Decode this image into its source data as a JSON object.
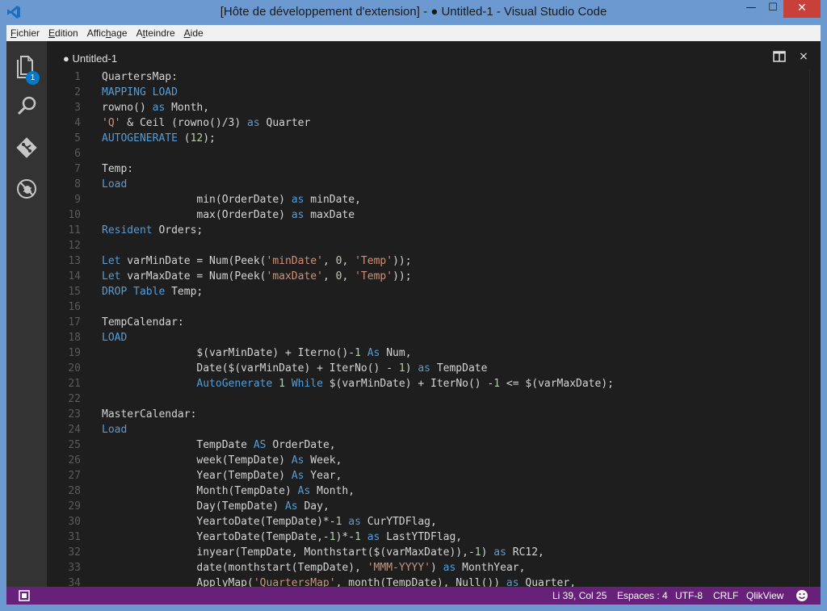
{
  "window": {
    "title": "[Hôte de développement d'extension] - ● Untitled-1 - Visual Studio Code",
    "minimize_glyph": "—",
    "maximize_glyph": "☐",
    "close_glyph": "✕"
  },
  "menu": {
    "items": [
      {
        "pre": "",
        "ul": "F",
        "post": "ichier"
      },
      {
        "pre": "",
        "ul": "E",
        "post": "dition"
      },
      {
        "pre": "Affic",
        "ul": "h",
        "post": "age"
      },
      {
        "pre": "A",
        "ul": "t",
        "post": "teindre"
      },
      {
        "pre": "",
        "ul": "A",
        "post": "ide"
      }
    ]
  },
  "activity": {
    "explorer_badge": "1",
    "icons": [
      "files-icon",
      "search-icon",
      "git-icon",
      "debug-icon"
    ]
  },
  "editor": {
    "tab_label": "● Untitled-1",
    "close_glyph": "×"
  },
  "code": {
    "lines": [
      {
        "n": "1",
        "t": [
          [
            "QuartersMap:",
            ""
          ]
        ]
      },
      {
        "n": "2",
        "t": [
          [
            "MAPPING LOAD",
            "kw"
          ]
        ]
      },
      {
        "n": "3",
        "t": [
          [
            "rowno() ",
            ""
          ],
          [
            "as",
            "kw"
          ],
          [
            " Month,",
            ""
          ]
        ]
      },
      {
        "n": "4",
        "t": [
          [
            "'Q'",
            "str"
          ],
          [
            " & Ceil (rowno()/3) ",
            ""
          ],
          [
            "as",
            "kw"
          ],
          [
            " Quarter",
            ""
          ]
        ]
      },
      {
        "n": "5",
        "t": [
          [
            "AUTOGENERATE",
            "kw"
          ],
          [
            " (",
            ""
          ],
          [
            "12",
            "num"
          ],
          [
            ");",
            ""
          ]
        ]
      },
      {
        "n": "6",
        "t": []
      },
      {
        "n": "7",
        "t": [
          [
            "Temp:",
            ""
          ]
        ]
      },
      {
        "n": "8",
        "t": [
          [
            "Load",
            "kw"
          ]
        ]
      },
      {
        "n": "9",
        "t": [
          [
            "               min(OrderDate) ",
            ""
          ],
          [
            "as",
            "kw"
          ],
          [
            " minDate,",
            ""
          ]
        ]
      },
      {
        "n": "10",
        "t": [
          [
            "               max(OrderDate) ",
            ""
          ],
          [
            "as",
            "kw"
          ],
          [
            " maxDate",
            ""
          ]
        ]
      },
      {
        "n": "11",
        "t": [
          [
            "Resident",
            "kw"
          ],
          [
            " Orders;",
            ""
          ]
        ]
      },
      {
        "n": "12",
        "t": []
      },
      {
        "n": "13",
        "t": [
          [
            "Let",
            "kw"
          ],
          [
            " varMinDate = Num(Peek(",
            ""
          ],
          [
            "'minDate'",
            "str"
          ],
          [
            ", ",
            ""
          ],
          [
            "0",
            "num"
          ],
          [
            ", ",
            ""
          ],
          [
            "'Temp'",
            "str"
          ],
          [
            "));",
            ""
          ]
        ]
      },
      {
        "n": "14",
        "t": [
          [
            "Let",
            "kw"
          ],
          [
            " varMaxDate = Num(Peek(",
            ""
          ],
          [
            "'maxDate'",
            "str"
          ],
          [
            ", ",
            ""
          ],
          [
            "0",
            "num"
          ],
          [
            ", ",
            ""
          ],
          [
            "'Temp'",
            "str"
          ],
          [
            "));",
            ""
          ]
        ]
      },
      {
        "n": "15",
        "t": [
          [
            "DROP",
            "kw"
          ],
          [
            " ",
            ""
          ],
          [
            "Table",
            "kw"
          ],
          [
            " Temp;",
            ""
          ]
        ]
      },
      {
        "n": "16",
        "t": []
      },
      {
        "n": "17",
        "t": [
          [
            "TempCalendar:",
            ""
          ]
        ]
      },
      {
        "n": "18",
        "t": [
          [
            "LOAD",
            "kw"
          ]
        ]
      },
      {
        "n": "19",
        "t": [
          [
            "               $(varMinDate) + Iterno()-",
            ""
          ],
          [
            "1",
            "num"
          ],
          [
            " ",
            ""
          ],
          [
            "As",
            "kw"
          ],
          [
            " Num,",
            ""
          ]
        ]
      },
      {
        "n": "20",
        "t": [
          [
            "               Date($(varMinDate) + IterNo() - ",
            ""
          ],
          [
            "1",
            "num"
          ],
          [
            ") ",
            ""
          ],
          [
            "as",
            "kw"
          ],
          [
            " TempDate",
            ""
          ]
        ]
      },
      {
        "n": "21",
        "t": [
          [
            "               ",
            ""
          ],
          [
            "AutoGenerate",
            "kw"
          ],
          [
            " ",
            ""
          ],
          [
            "1",
            "num"
          ],
          [
            " ",
            ""
          ],
          [
            "While",
            "kw"
          ],
          [
            " $(varMinDate) + IterNo() -",
            ""
          ],
          [
            "1",
            "num"
          ],
          [
            " <= $(varMaxDate);",
            ""
          ]
        ]
      },
      {
        "n": "22",
        "t": []
      },
      {
        "n": "23",
        "t": [
          [
            "MasterCalendar:",
            ""
          ]
        ]
      },
      {
        "n": "24",
        "t": [
          [
            "Load",
            "kw"
          ]
        ]
      },
      {
        "n": "25",
        "t": [
          [
            "               TempDate ",
            ""
          ],
          [
            "AS",
            "kw"
          ],
          [
            " OrderDate,",
            ""
          ]
        ]
      },
      {
        "n": "26",
        "t": [
          [
            "               week(TempDate) ",
            ""
          ],
          [
            "As",
            "kw"
          ],
          [
            " Week,",
            ""
          ]
        ]
      },
      {
        "n": "27",
        "t": [
          [
            "               Year(TempDate) ",
            ""
          ],
          [
            "As",
            "kw"
          ],
          [
            " Year,",
            ""
          ]
        ]
      },
      {
        "n": "28",
        "t": [
          [
            "               Month(TempDate) ",
            ""
          ],
          [
            "As",
            "kw"
          ],
          [
            " Month,",
            ""
          ]
        ]
      },
      {
        "n": "29",
        "t": [
          [
            "               Day(TempDate) ",
            ""
          ],
          [
            "As",
            "kw"
          ],
          [
            " Day,",
            ""
          ]
        ]
      },
      {
        "n": "30",
        "t": [
          [
            "               YeartoDate(TempDate)*-",
            ""
          ],
          [
            "1",
            "num"
          ],
          [
            " ",
            ""
          ],
          [
            "as",
            "kw"
          ],
          [
            " CurYTDFlag,",
            ""
          ]
        ]
      },
      {
        "n": "31",
        "t": [
          [
            "               YeartoDate(TempDate,-",
            ""
          ],
          [
            "1",
            "num"
          ],
          [
            ")*-",
            ""
          ],
          [
            "1",
            "num"
          ],
          [
            " ",
            ""
          ],
          [
            "as",
            "kw"
          ],
          [
            " LastYTDFlag,",
            ""
          ]
        ]
      },
      {
        "n": "32",
        "t": [
          [
            "               inyear(TempDate, Monthstart($(varMaxDate)),-",
            ""
          ],
          [
            "1",
            "num"
          ],
          [
            ") ",
            ""
          ],
          [
            "as",
            "kw"
          ],
          [
            " RC12,",
            ""
          ]
        ]
      },
      {
        "n": "33",
        "t": [
          [
            "               date(monthstart(TempDate), ",
            ""
          ],
          [
            "'MMM-YYYY'",
            "str"
          ],
          [
            ") ",
            ""
          ],
          [
            "as",
            "kw"
          ],
          [
            " MonthYear,",
            ""
          ]
        ]
      },
      {
        "n": "34",
        "t": [
          [
            "               ApplyMap(",
            ""
          ],
          [
            "'QuartersMap'",
            "str"
          ],
          [
            ", month(TempDate), Null()) ",
            ""
          ],
          [
            "as",
            "kw"
          ],
          [
            " Quarter,",
            ""
          ]
        ]
      }
    ]
  },
  "status": {
    "position": "Li 39, Col 25",
    "indent": "Espaces : 4",
    "encoding": "UTF-8",
    "eol": "CRLF",
    "language": "QlikView"
  },
  "colors": {
    "status_bar": "#68217a",
    "keyword": "#569cd6",
    "string": "#ce9178",
    "number": "#b5cea8",
    "badge": "#007acc"
  }
}
